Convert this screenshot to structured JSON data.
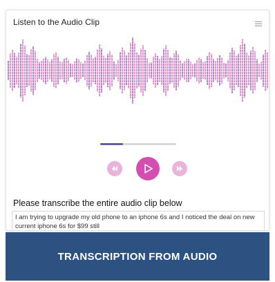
{
  "card": {
    "title": "Listen to the Audio Clip",
    "menu_icon": "hamburger-menu-icon"
  },
  "player": {
    "progress_fraction": 0.3,
    "rewind_icon": "rewind-icon",
    "play_icon": "play-icon",
    "forward_icon": "forward-icon"
  },
  "transcription": {
    "prompt": "Please transcribe the entire audio clip below",
    "text": "I am trying to upgrade my old phone to an iphone 6s and I noticed the deal on new current iphone 6s for $99 still"
  },
  "banner": {
    "label": "TRANSCRIPTION FROM AUDIO"
  },
  "colors": {
    "wave_pink": "#e07bc7",
    "wave_purple": "#a06bc9",
    "play_button": "#d44eb2",
    "side_button": "#e9b3dc",
    "progress": "#6b5aa8",
    "banner": "#2c5282"
  }
}
